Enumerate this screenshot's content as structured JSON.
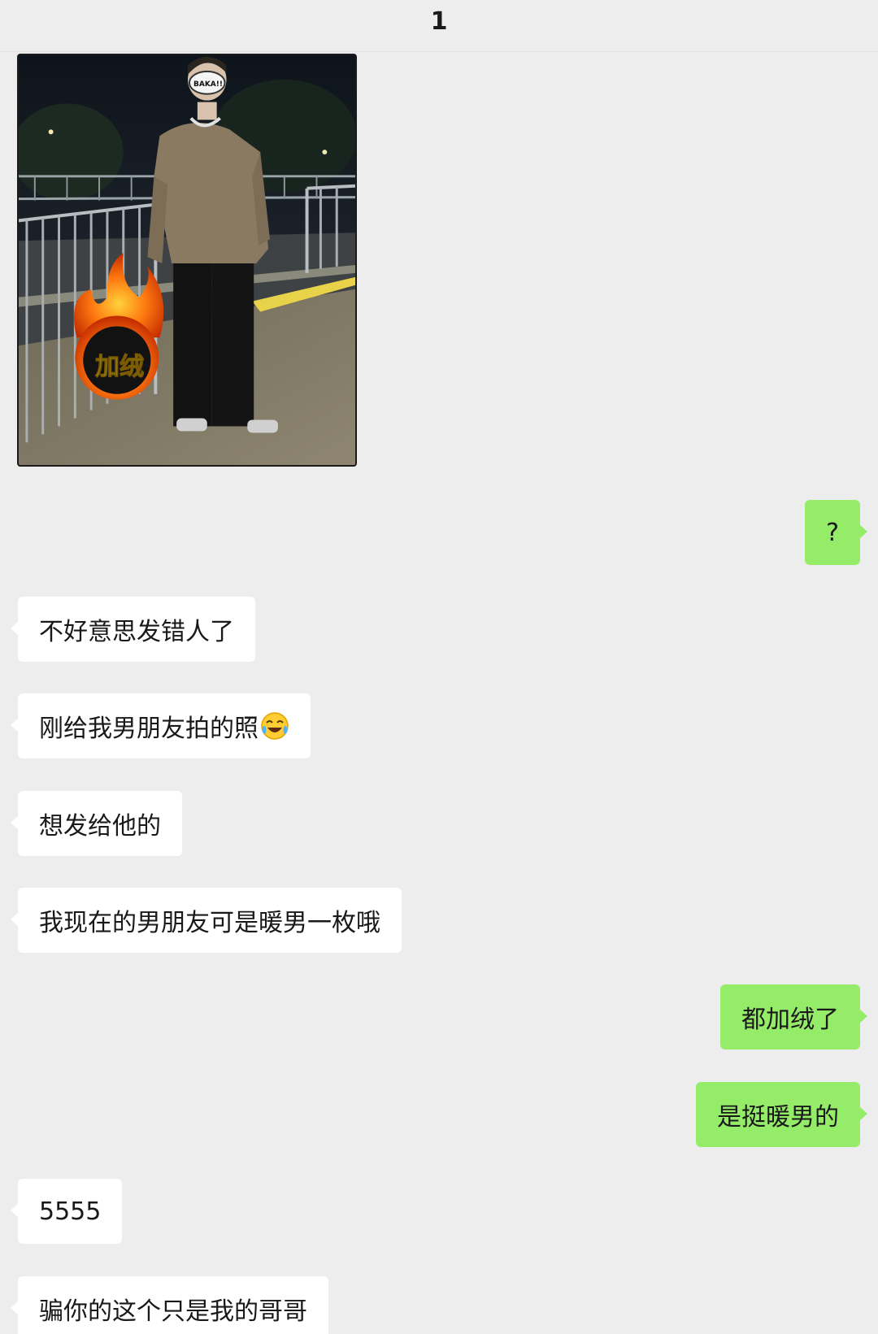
{
  "header": {
    "title": "1"
  },
  "photo": {
    "overlay_text": "加绒",
    "mask_text": "BAKA!!"
  },
  "messages": [
    {
      "side": "right",
      "text": "?"
    },
    {
      "side": "left",
      "text": "不好意思发错人了"
    },
    {
      "side": "left",
      "text": "刚给我男朋友拍的照",
      "emoji": "laughing-crying-emoji"
    },
    {
      "side": "left",
      "text": "想发给他的"
    },
    {
      "side": "left",
      "text": "我现在的男朋友可是暖男一枚哦"
    },
    {
      "side": "right",
      "text": "都加绒了"
    },
    {
      "side": "right",
      "text": "是挺暖男的"
    },
    {
      "side": "left",
      "text": "5555"
    },
    {
      "side": "left",
      "text": "骗你的这个只是我的哥哥"
    }
  ],
  "colors": {
    "background": "#ededed",
    "incoming_bubble": "#ffffff",
    "outgoing_bubble": "#95ec69"
  }
}
